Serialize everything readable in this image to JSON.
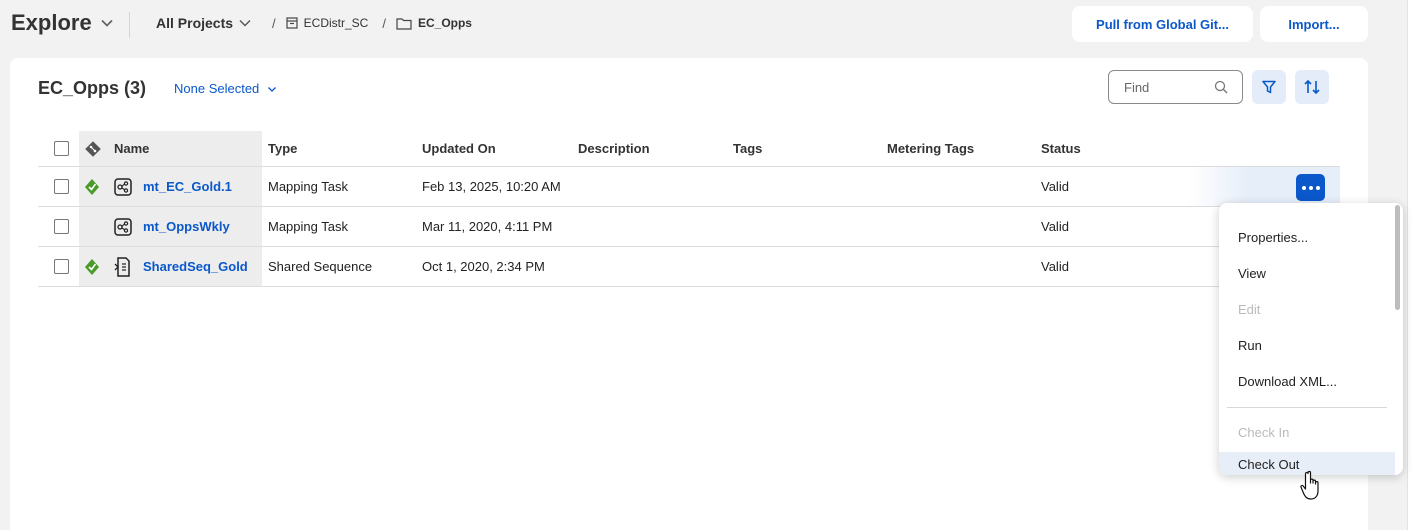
{
  "header": {
    "title": "Explore",
    "breadcrumb_root": "All Projects",
    "breadcrumb_project": "ECDistr_SC",
    "breadcrumb_folder": "EC_Opps",
    "pull_button": "Pull from Global Git...",
    "import_button": "Import..."
  },
  "toolbar": {
    "title": "EC_Opps (3)",
    "selection": "None Selected",
    "find_placeholder": "Find"
  },
  "table": {
    "columns": {
      "name": "Name",
      "type": "Type",
      "updated": "Updated On",
      "description": "Description",
      "tags": "Tags",
      "metering_tags": "Metering Tags",
      "status": "Status"
    },
    "rows": [
      {
        "name": "mt_EC_Gold.1",
        "type": "Mapping Task",
        "updated": "Feb 13, 2025, 10:20 AM",
        "description": "",
        "tags": "",
        "metering_tags": "",
        "status": "Valid",
        "git": true,
        "icon": "mapping-task-icon"
      },
      {
        "name": "mt_OppsWkly",
        "type": "Mapping Task",
        "updated": "Mar 11, 2020, 4:11 PM",
        "description": "",
        "tags": "",
        "metering_tags": "",
        "status": "Valid",
        "git": false,
        "icon": "mapping-task-icon"
      },
      {
        "name": "SharedSeq_Gold",
        "type": "Shared Sequence",
        "updated": "Oct 1, 2020, 2:34 PM",
        "description": "",
        "tags": "",
        "metering_tags": "",
        "status": "Valid",
        "git": true,
        "icon": "shared-sequence-icon"
      }
    ]
  },
  "menu": {
    "items": [
      {
        "label": "Properties...",
        "disabled": false
      },
      {
        "label": "View",
        "disabled": false
      },
      {
        "label": "Edit",
        "disabled": true
      },
      {
        "label": "Run",
        "disabled": false
      },
      {
        "label": "Download XML...",
        "disabled": false
      },
      {
        "label": "Check In",
        "disabled": true
      },
      {
        "label": "Check Out",
        "disabled": false,
        "hovered": true
      }
    ]
  },
  "colors": {
    "accent": "#0a58ca",
    "git_green": "#4a9a2a",
    "background": "#f2f2f2"
  }
}
